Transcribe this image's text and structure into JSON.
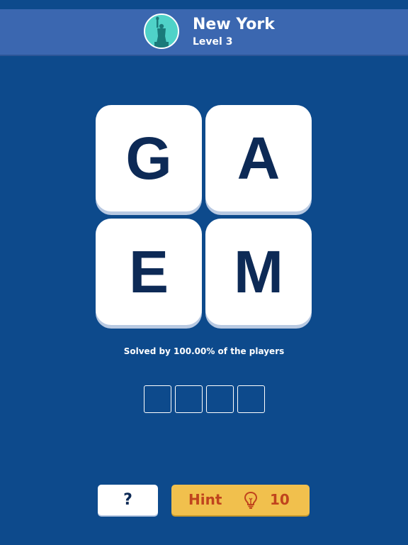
{
  "header": {
    "title": "New York",
    "level": "Level 3",
    "avatar_icon": "statue-of-liberty-icon"
  },
  "tiles": [
    "G",
    "A",
    "E",
    "M"
  ],
  "solved_text": "Solved by 100.00% of the players",
  "answer_slots": 4,
  "buttons": {
    "question_label": "?",
    "hint_label": "Hint",
    "hint_icon": "lightbulb-icon",
    "hint_count": "10"
  },
  "colors": {
    "background": "#0d4a8c",
    "header": "#3b67b0",
    "tile": "#ffffff",
    "letter": "#0d2a56",
    "hint_button": "#f1c04d",
    "hint_text": "#c0441d"
  }
}
